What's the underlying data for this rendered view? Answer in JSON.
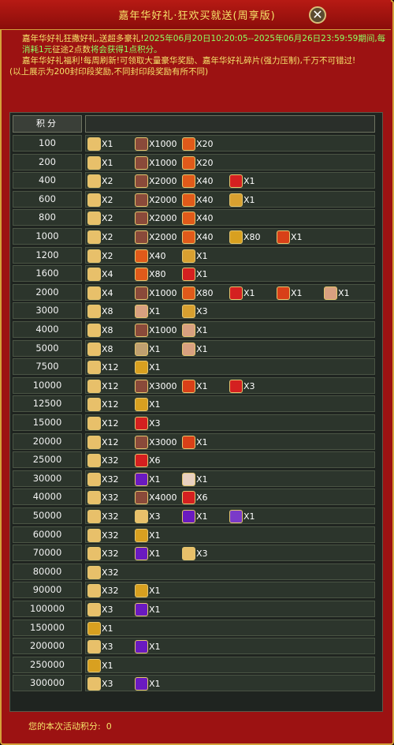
{
  "title": "嘉年华好礼·狂欢买就送(周享版)",
  "info": {
    "line1a": "嘉年华好礼狂撒好礼,送超多豪礼!",
    "line1b": "2025年06月20日10:20:05--2025年06月26日23:59:59期间,每消耗1元",
    "line1c": "征途2点数",
    "line1d": "将会获得1点积分。",
    "line2": "嘉年华好礼福利!每周刷新!可领取大量豪华奖励、嘉年华好礼碎片(强力压制),千万不可错过!",
    "line3": "(以上展示为200封印段奖励,不同封印段奖励有所不同)"
  },
  "table_header": "积分",
  "colors": {
    "scroll": "#e8c06a",
    "meat": "#8a4a3a",
    "pepper": "#e05a1a",
    "gift": "#d42020",
    "giftgold": "#d8a030",
    "orb": "#d8a020",
    "fire": "#d84018",
    "rose": "#d8a080",
    "eye": "#c0a070",
    "purple": "#6a1ac0",
    "card": "#7a3ac8",
    "dragon": "#e8d0c0"
  },
  "rows": [
    {
      "points": "100",
      "items": [
        {
          "icon": "scroll",
          "qty": "X1"
        },
        {
          "icon": "meat",
          "qty": "X1000"
        },
        {
          "icon": "pepper",
          "qty": "X20"
        }
      ]
    },
    {
      "points": "200",
      "items": [
        {
          "icon": "scroll",
          "qty": "X1"
        },
        {
          "icon": "meat",
          "qty": "X1000"
        },
        {
          "icon": "pepper",
          "qty": "X20"
        }
      ]
    },
    {
      "points": "400",
      "items": [
        {
          "icon": "scroll",
          "qty": "X2"
        },
        {
          "icon": "meat",
          "qty": "X2000"
        },
        {
          "icon": "pepper",
          "qty": "X40"
        },
        {
          "icon": "gift",
          "qty": "X1"
        }
      ]
    },
    {
      "points": "600",
      "items": [
        {
          "icon": "scroll",
          "qty": "X2"
        },
        {
          "icon": "meat",
          "qty": "X2000"
        },
        {
          "icon": "pepper",
          "qty": "X40"
        },
        {
          "icon": "giftgold",
          "qty": "X1"
        }
      ]
    },
    {
      "points": "800",
      "items": [
        {
          "icon": "scroll",
          "qty": "X2"
        },
        {
          "icon": "meat",
          "qty": "X2000"
        },
        {
          "icon": "pepper",
          "qty": "X40"
        }
      ]
    },
    {
      "points": "1000",
      "items": [
        {
          "icon": "scroll",
          "qty": "X2"
        },
        {
          "icon": "meat",
          "qty": "X2000"
        },
        {
          "icon": "pepper",
          "qty": "X40"
        },
        {
          "icon": "orb",
          "qty": "X80"
        },
        {
          "icon": "fire",
          "qty": "X1"
        }
      ]
    },
    {
      "points": "1200",
      "items": [
        {
          "icon": "scroll",
          "qty": "X2"
        },
        {
          "icon": "pepper",
          "qty": "X40"
        },
        {
          "icon": "giftgold",
          "qty": "X1"
        }
      ]
    },
    {
      "points": "1600",
      "items": [
        {
          "icon": "scroll",
          "qty": "X4"
        },
        {
          "icon": "pepper",
          "qty": "X80"
        },
        {
          "icon": "gift",
          "qty": "X1"
        }
      ]
    },
    {
      "points": "2000",
      "items": [
        {
          "icon": "scroll",
          "qty": "X4"
        },
        {
          "icon": "meat",
          "qty": "X1000"
        },
        {
          "icon": "pepper",
          "qty": "X80"
        },
        {
          "icon": "gift",
          "qty": "X1"
        },
        {
          "icon": "fire",
          "qty": "X1"
        },
        {
          "icon": "rose",
          "qty": "X1"
        }
      ]
    },
    {
      "points": "3000",
      "items": [
        {
          "icon": "scroll",
          "qty": "X8"
        },
        {
          "icon": "rose",
          "qty": "X1"
        },
        {
          "icon": "giftgold",
          "qty": "X3"
        }
      ]
    },
    {
      "points": "4000",
      "items": [
        {
          "icon": "scroll",
          "qty": "X8"
        },
        {
          "icon": "meat",
          "qty": "X1000"
        },
        {
          "icon": "rose",
          "qty": "X1"
        }
      ]
    },
    {
      "points": "5000",
      "items": [
        {
          "icon": "scroll",
          "qty": "X8"
        },
        {
          "icon": "eye",
          "qty": "X1"
        },
        {
          "icon": "rose",
          "qty": "X1"
        }
      ]
    },
    {
      "points": "7500",
      "items": [
        {
          "icon": "scroll",
          "qty": "X12"
        },
        {
          "icon": "orb",
          "qty": "X1"
        }
      ]
    },
    {
      "points": "10000",
      "items": [
        {
          "icon": "scroll",
          "qty": "X12"
        },
        {
          "icon": "meat",
          "qty": "X3000"
        },
        {
          "icon": "fire",
          "qty": "X1"
        },
        {
          "icon": "gift",
          "qty": "X3"
        }
      ]
    },
    {
      "points": "12500",
      "items": [
        {
          "icon": "scroll",
          "qty": "X12"
        },
        {
          "icon": "orb",
          "qty": "X1"
        }
      ]
    },
    {
      "points": "15000",
      "items": [
        {
          "icon": "scroll",
          "qty": "X12"
        },
        {
          "icon": "gift",
          "qty": "X3"
        }
      ]
    },
    {
      "points": "20000",
      "items": [
        {
          "icon": "scroll",
          "qty": "X12"
        },
        {
          "icon": "meat",
          "qty": "X3000"
        },
        {
          "icon": "fire",
          "qty": "X1"
        }
      ]
    },
    {
      "points": "25000",
      "items": [
        {
          "icon": "scroll",
          "qty": "X32"
        },
        {
          "icon": "gift",
          "qty": "X6"
        }
      ]
    },
    {
      "points": "30000",
      "items": [
        {
          "icon": "scroll",
          "qty": "X32"
        },
        {
          "icon": "purple",
          "qty": "X1"
        },
        {
          "icon": "dragon",
          "qty": "X1"
        }
      ]
    },
    {
      "points": "40000",
      "items": [
        {
          "icon": "scroll",
          "qty": "X32"
        },
        {
          "icon": "meat",
          "qty": "X4000"
        },
        {
          "icon": "gift",
          "qty": "X6"
        }
      ]
    },
    {
      "points": "50000",
      "items": [
        {
          "icon": "scroll",
          "qty": "X32"
        },
        {
          "icon": "scroll",
          "qty": "X3"
        },
        {
          "icon": "purple",
          "qty": "X1"
        },
        {
          "icon": "card",
          "qty": "X1"
        }
      ]
    },
    {
      "points": "60000",
      "items": [
        {
          "icon": "scroll",
          "qty": "X32"
        },
        {
          "icon": "orb",
          "qty": "X1"
        }
      ]
    },
    {
      "points": "70000",
      "items": [
        {
          "icon": "scroll",
          "qty": "X32"
        },
        {
          "icon": "purple",
          "qty": "X1"
        },
        {
          "icon": "scroll",
          "qty": "X3"
        }
      ]
    },
    {
      "points": "80000",
      "items": [
        {
          "icon": "scroll",
          "qty": "X32"
        }
      ]
    },
    {
      "points": "90000",
      "items": [
        {
          "icon": "scroll",
          "qty": "X32"
        },
        {
          "icon": "orb",
          "qty": "X1"
        }
      ]
    },
    {
      "points": "100000",
      "items": [
        {
          "icon": "scroll",
          "qty": "X3"
        },
        {
          "icon": "purple",
          "qty": "X1"
        }
      ]
    },
    {
      "points": "150000",
      "items": [
        {
          "icon": "orb",
          "qty": "X1"
        }
      ]
    },
    {
      "points": "200000",
      "items": [
        {
          "icon": "scroll",
          "qty": "X3"
        },
        {
          "icon": "purple",
          "qty": "X1"
        }
      ]
    },
    {
      "points": "250000",
      "items": [
        {
          "icon": "orb",
          "qty": "X1"
        }
      ]
    },
    {
      "points": "300000",
      "items": [
        {
          "icon": "scroll",
          "qty": "X3"
        },
        {
          "icon": "purple",
          "qty": "X1"
        }
      ]
    }
  ],
  "footer": {
    "label": "您的本次活动积分:",
    "value": "0"
  }
}
